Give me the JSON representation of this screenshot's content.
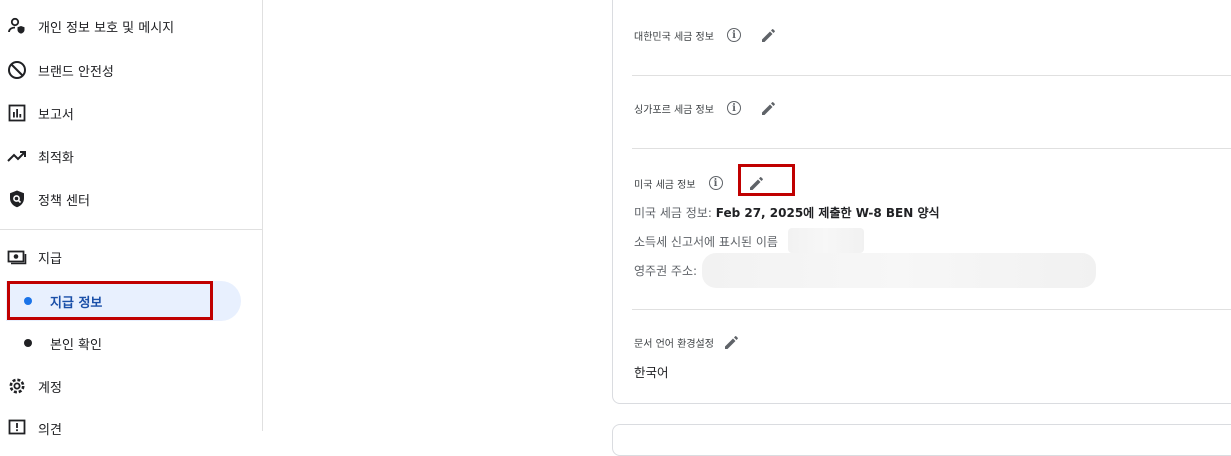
{
  "sidebar": {
    "items": [
      {
        "label": "개인 정보 보호 및 메시지",
        "icon": "person-shield-icon"
      },
      {
        "label": "브랜드 안전성",
        "icon": "block-icon"
      },
      {
        "label": "보고서",
        "icon": "bar-chart-icon"
      },
      {
        "label": "최적화",
        "icon": "trending-up-icon"
      },
      {
        "label": "정책 센터",
        "icon": "policy-shield-icon"
      },
      {
        "label": "지급",
        "icon": "payments-icon"
      },
      {
        "label": "계정",
        "icon": "gear-icon"
      },
      {
        "label": "의견",
        "icon": "feedback-icon"
      }
    ],
    "sub_items": [
      {
        "label": "지급 정보",
        "active": true
      },
      {
        "label": "본인 확인",
        "active": false
      }
    ]
  },
  "main": {
    "korea_tax_label": "대한민국 세금 정보",
    "singapore_tax_label": "싱가포르 세금 정보",
    "us_tax_label": "미국 세금 정보",
    "us_tax_info_prefix": "미국 세금 정보: ",
    "us_tax_info_value": "Feb 27, 2025에 제출한 W-8 BEN 양식",
    "tax_name_label": "소득세 신고서에 표시된 이름",
    "residence_address_label": "영주권 주소:",
    "doc_language_label": "문서 언어 환경설정",
    "doc_language_value": "한국어"
  },
  "colors": {
    "highlight": "#c00000",
    "active_bg": "#e8f0fe",
    "active_text": "#1a4fa8"
  }
}
